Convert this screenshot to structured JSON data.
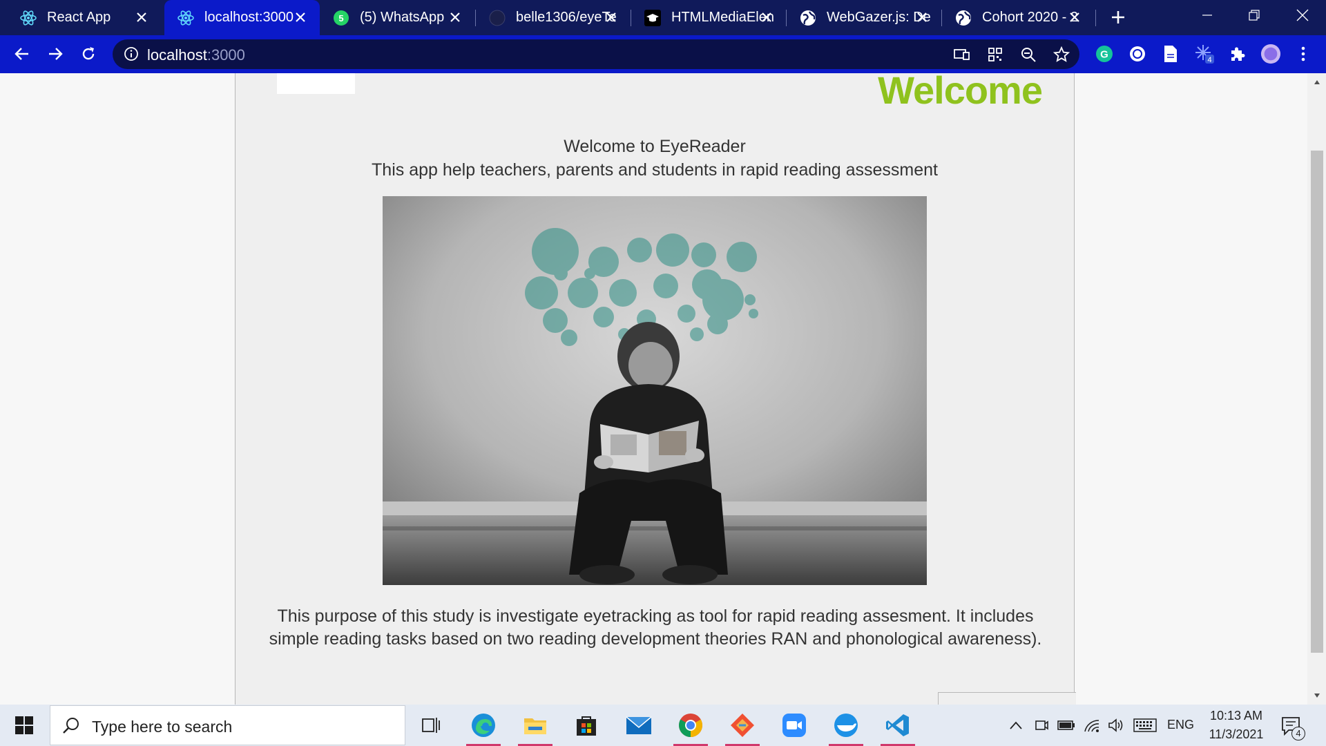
{
  "browser": {
    "tabs": [
      {
        "title": "React App",
        "icon": "react-icon",
        "active": false
      },
      {
        "title": "localhost:3000",
        "icon": "react-icon",
        "active": true
      },
      {
        "title": "(5) WhatsApp",
        "icon": "whatsapp-icon",
        "active": false
      },
      {
        "title": "belle1306/eyeTe",
        "icon": "github-icon",
        "active": false
      },
      {
        "title": "HTMLMediaElen",
        "icon": "graduation-cap-icon",
        "active": false
      },
      {
        "title": "WebGazer.js: De",
        "icon": "globe-icon",
        "active": false
      },
      {
        "title": "Cohort 2020 - 2",
        "icon": "globe-icon",
        "active": false
      }
    ],
    "address": {
      "host": "localhost",
      "port": ":3000"
    },
    "extension_badge": "4",
    "colors": {
      "tabstrip": "#101a5a",
      "active_tab": "#0b1ac9",
      "toolbar": "#0b1ac9",
      "omnibox": "#0a1048"
    }
  },
  "page": {
    "heading": "Welcome",
    "intro_title": "Welcome to EyeReader",
    "intro_subtitle": "This app help teachers, parents and students in rapid reading assessment",
    "hero_image": "child-reading-book-with-bubbles",
    "purpose_line1": "This purpose of this study is investigate eyetracking as tool for rapid reading assesment. It includes",
    "purpose_line2": "simple reading tasks based on two reading development theories RAN and phonological awareness).",
    "colors": {
      "heading": "#8fc21e",
      "card": "#efefef",
      "text": "#333333"
    }
  },
  "taskbar": {
    "search_placeholder": "Type here to search",
    "apps": [
      "task-view",
      "edge",
      "file-explorer",
      "store",
      "mail",
      "chrome",
      "git",
      "zoom",
      "docker",
      "vscode"
    ],
    "language": "ENG",
    "time": "10:13 AM",
    "date": "11/3/2021",
    "notification_count": "4"
  }
}
